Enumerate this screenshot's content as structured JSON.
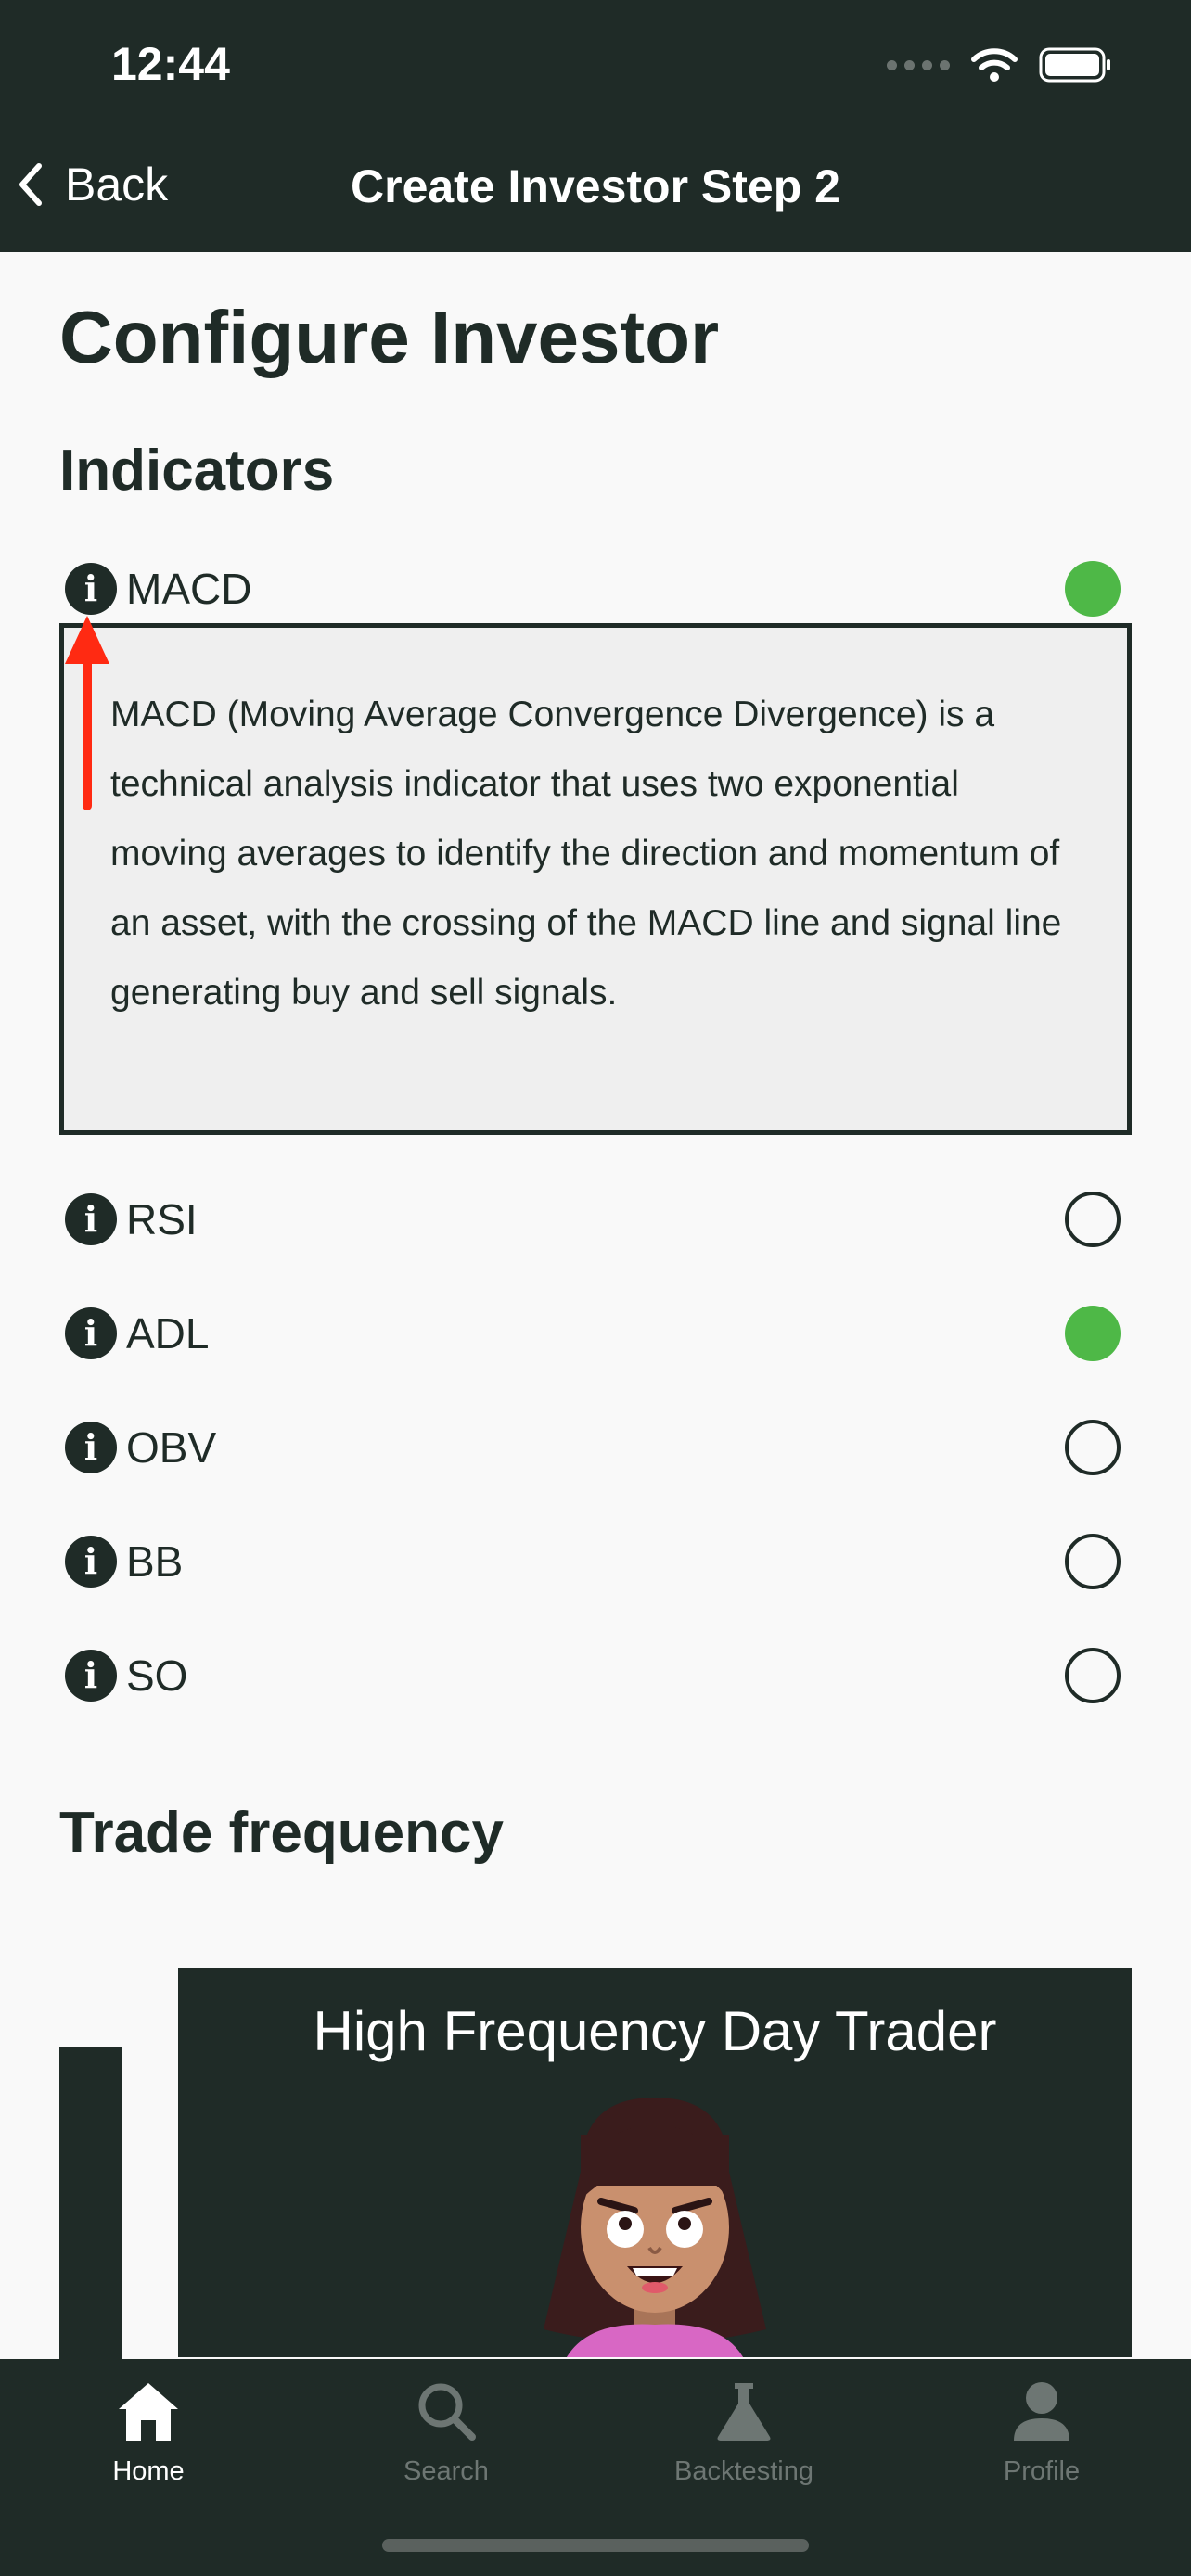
{
  "status_bar": {
    "time": "12:44"
  },
  "nav": {
    "back_label": "Back",
    "title": "Create Investor Step 2"
  },
  "page": {
    "title": "Configure Investor"
  },
  "indicators": {
    "section_title": "Indicators",
    "info_glyph": "i",
    "items": [
      {
        "label": "MACD",
        "selected": true
      },
      {
        "label": "RSI",
        "selected": false
      },
      {
        "label": "ADL",
        "selected": true
      },
      {
        "label": "OBV",
        "selected": false
      },
      {
        "label": "BB",
        "selected": false
      },
      {
        "label": "SO",
        "selected": false
      }
    ],
    "description": "MACD (Moving Average Convergence Divergence) is a technical analysis indicator that uses two exponential moving averages to identify the direction and momentum of an asset, with the crossing of the MACD line and signal line generating buy and sell signals."
  },
  "trade_frequency": {
    "section_title": "Trade frequency",
    "card_title": "High Frequency Day Trader"
  },
  "tabbar": {
    "tabs": [
      {
        "label": "Home",
        "icon": "home-icon",
        "active": true
      },
      {
        "label": "Search",
        "icon": "search-icon",
        "active": false
      },
      {
        "label": "Backtesting",
        "icon": "flask-icon",
        "active": false
      },
      {
        "label": "Profile",
        "icon": "person-icon",
        "active": false
      }
    ]
  },
  "colors": {
    "header_bg": "#1f2b27",
    "selected_green": "#4eb847",
    "arrow_red": "#ff2a12",
    "page_bg": "#f9f9f9"
  }
}
